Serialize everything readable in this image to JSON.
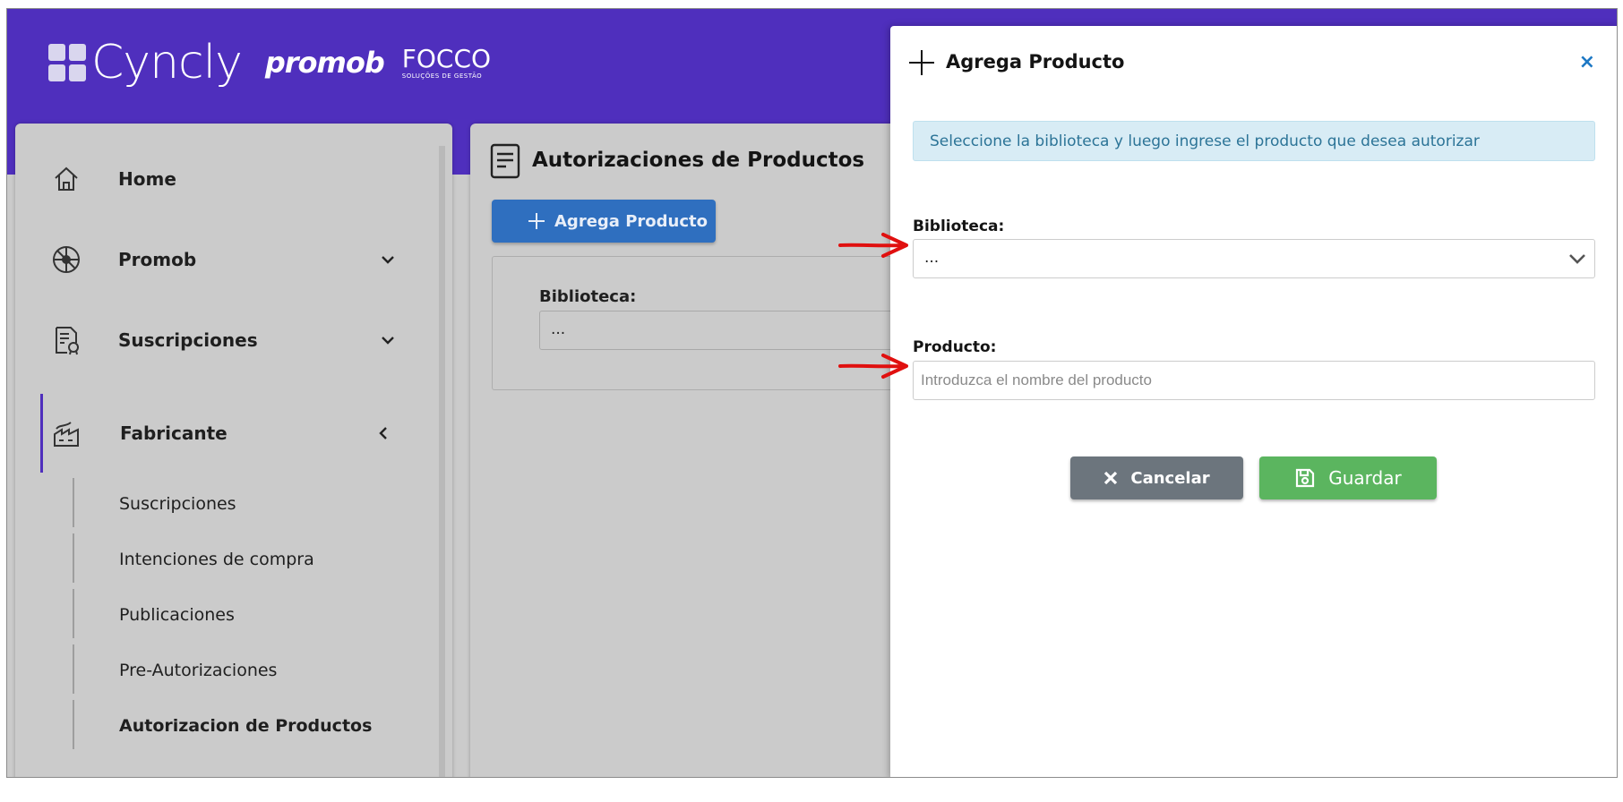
{
  "brand": {
    "cyncly": "Cyncly",
    "promob": "promob",
    "focco": "FOCCO",
    "focco_sub": "SOLUÇÕES DE GESTÃO"
  },
  "sidebar": {
    "items": [
      {
        "label": "Home",
        "icon": "home-icon"
      },
      {
        "label": "Promob",
        "icon": "promob-icon"
      },
      {
        "label": "Suscripciones",
        "icon": "certificate-icon"
      },
      {
        "label": "Fabricante",
        "icon": "factory-icon"
      }
    ],
    "subitems": [
      {
        "label": "Suscripciones"
      },
      {
        "label": "Intenciones de compra"
      },
      {
        "label": "Publicaciones"
      },
      {
        "label": "Pre-Autorizaciones"
      },
      {
        "label": "Autorizacion de Productos"
      }
    ]
  },
  "main": {
    "title": "Autorizaciones de Productos",
    "add_button": "Agrega Producto",
    "filter_label": "Biblioteca:",
    "filter_value": "..."
  },
  "modal": {
    "title": "Agrega Producto",
    "close": "×",
    "info": "Seleccione la biblioteca y luego ingrese el producto que desea autorizar",
    "library_label": "Biblioteca:",
    "library_value": "...",
    "product_label": "Producto:",
    "product_placeholder": "Introduzca el nombre del producto",
    "cancel_label": "Cancelar",
    "save_label": "Guardar"
  },
  "colors": {
    "topbar": "#4f2fbd",
    "primary_button": "#2f6fbf",
    "cancel_button": "#6c757d",
    "save_button": "#5bb55f",
    "annotation_arrow": "#e0100f"
  }
}
